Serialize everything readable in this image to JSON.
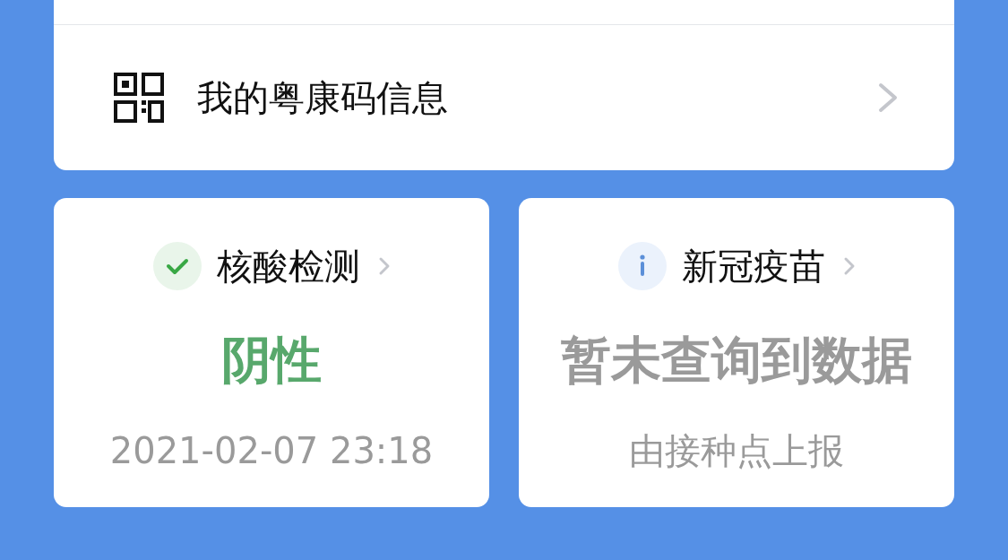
{
  "code_row": {
    "label": "我的粤康码信息"
  },
  "cards": [
    {
      "kind": "success",
      "title": "核酸检测",
      "result": "阴性",
      "detail": "2021-02-07 23:18"
    },
    {
      "kind": "info",
      "title": "新冠疫苗",
      "result": "暂未查询到数据",
      "detail": "由接种点上报"
    }
  ]
}
